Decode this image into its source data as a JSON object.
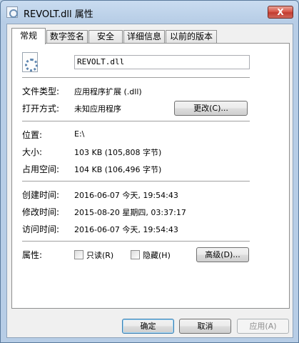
{
  "window": {
    "title": "REVOLT.dll 属性",
    "close_label": "X"
  },
  "tabs": [
    {
      "label": "常规",
      "active": true
    },
    {
      "label": "数字签名"
    },
    {
      "label": "安全"
    },
    {
      "label": "详细信息"
    },
    {
      "label": "以前的版本"
    }
  ],
  "general": {
    "file_name": "REVOLT.dll",
    "type_label": "文件类型:",
    "type_value": "应用程序扩展 (.dll)",
    "opens_label": "打开方式:",
    "opens_value": "未知应用程序",
    "change_button": "更改(C)...",
    "location_label": "位置:",
    "location_value": "E:\\",
    "size_label": "大小:",
    "size_value": "103 KB (105,808 字节)",
    "disk_label": "占用空间:",
    "disk_value": "104 KB (106,496 字节)",
    "created_label": "创建时间:",
    "created_value": "2016-06-07 今天, 19:54:43",
    "modified_label": "修改时间:",
    "modified_value": "2015-08-20 星期四, 03:37:17",
    "accessed_label": "访问时间:",
    "accessed_value": "2016-06-07 今天, 19:54:43",
    "attr_label": "属性:",
    "readonly_label": "只读(R)",
    "hidden_label": "隐藏(H)",
    "advanced_button": "高级(D)..."
  },
  "footer": {
    "ok": "确定",
    "cancel": "取消",
    "apply": "应用(A)"
  },
  "icons": {
    "title": "dll-file-icon",
    "file": "dll-file-icon",
    "close": "close-icon"
  }
}
